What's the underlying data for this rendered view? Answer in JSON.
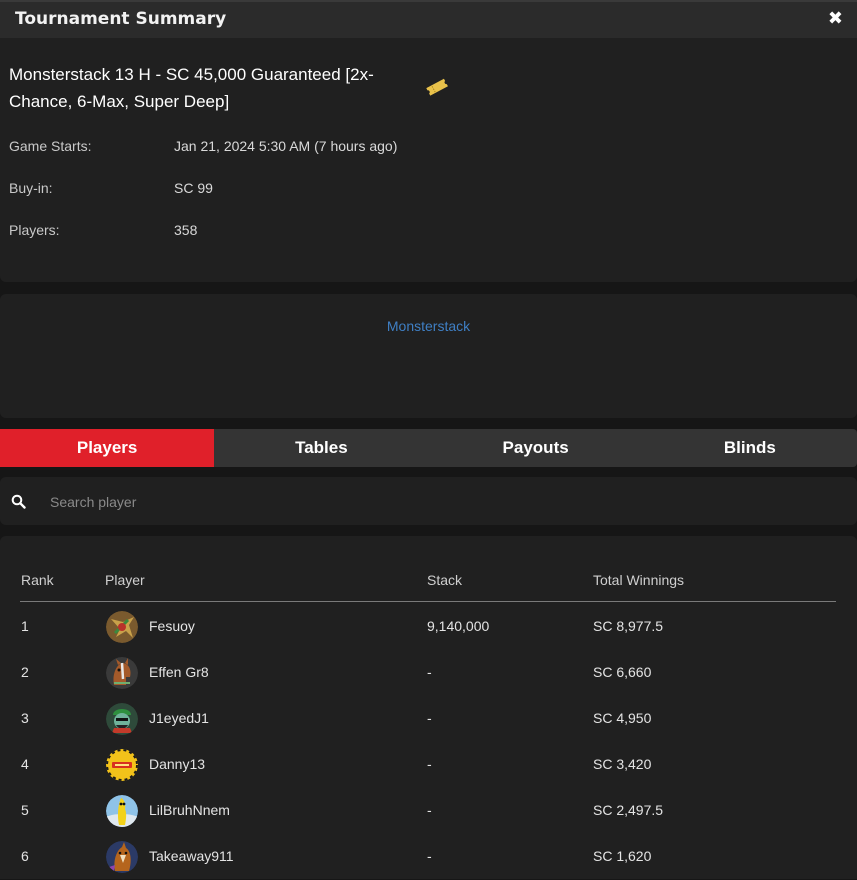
{
  "header": {
    "title": "Tournament Summary",
    "close_icon": "close-icon"
  },
  "tournament": {
    "name": "Monsterstack 13 H - SC 45,000 Guaranteed [2x-Chance, 6-Max, Super Deep]",
    "ticket_icon": "ticket-icon",
    "game_starts_label": "Game Starts:",
    "game_starts_value": "Jan 21, 2024 5:30 AM (7 hours ago)",
    "buyin_label": "Buy-in:",
    "buyin_value": "SC 99",
    "players_label": "Players:",
    "players_value": "358"
  },
  "description": {
    "link": "Monsterstack"
  },
  "tabs": [
    {
      "label": "Players",
      "active": true
    },
    {
      "label": "Tables",
      "active": false
    },
    {
      "label": "Payouts",
      "active": false
    },
    {
      "label": "Blinds",
      "active": false
    }
  ],
  "search": {
    "placeholder": "Search player",
    "icon": "search-icon"
  },
  "table": {
    "headers": {
      "rank": "Rank",
      "player": "Player",
      "stack": "Stack",
      "winnings": "Total Winnings"
    },
    "rows": [
      {
        "rank": "1",
        "player": "Fesuoy",
        "stack": "9,140,000",
        "winnings": "SC 8,977.5"
      },
      {
        "rank": "2",
        "player": "Effen Gr8",
        "stack": "-",
        "winnings": "SC 6,660"
      },
      {
        "rank": "3",
        "player": "J1eyedJ1",
        "stack": "-",
        "winnings": "SC 4,950"
      },
      {
        "rank": "4",
        "player": "Danny13",
        "stack": "-",
        "winnings": "SC 3,420"
      },
      {
        "rank": "5",
        "player": "LilBruhNnem",
        "stack": "-",
        "winnings": "SC 2,497.5"
      },
      {
        "rank": "6",
        "player": "Takeaway911",
        "stack": "-",
        "winnings": "SC 1,620"
      }
    ]
  },
  "colors": {
    "accent": "#e0202a",
    "link": "#3f7fc4",
    "panel": "#202020",
    "background": "#161616"
  }
}
